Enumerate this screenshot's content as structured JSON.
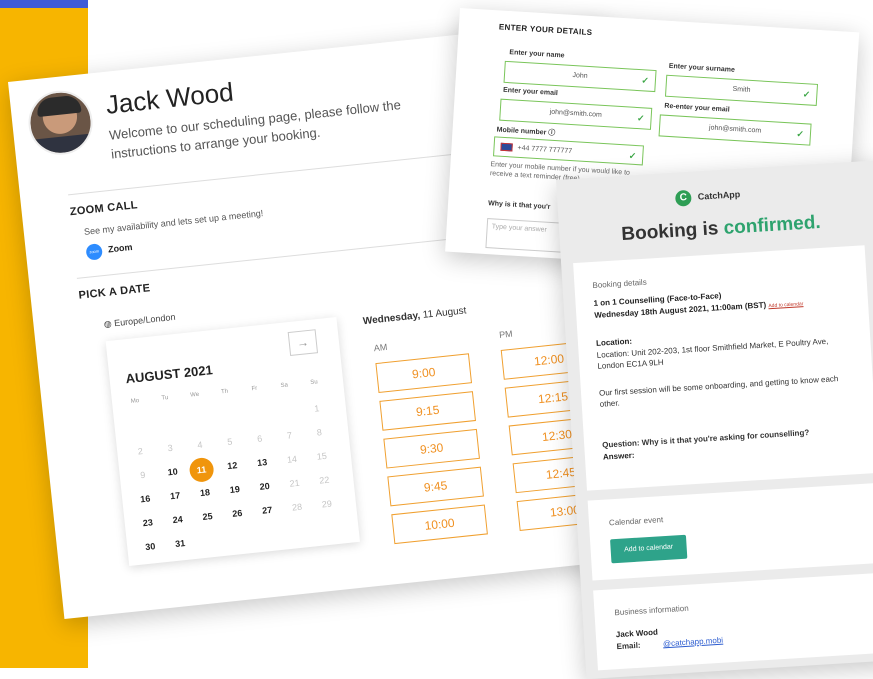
{
  "scheduler": {
    "name": "Jack Wood",
    "welcome": "Welcome to our scheduling page, please follow the instructions to arrange your booking.",
    "zoom_call_heading": "ZOOM CALL",
    "zoom_desc": "See my availability and lets set up a meeting!",
    "zoom_label": "Zoom",
    "zoom_logo_text": "zoom",
    "pick_date_heading": "PICK A DATE",
    "timezone": "Europe/London",
    "month": "AUGUST 2021",
    "next_arrow": "→",
    "weekdays": [
      "Mo",
      "Tu",
      "We",
      "Th",
      "Fr",
      "Sa",
      "Su"
    ],
    "selected_day": "11",
    "date_heading_day": "Wednesday,",
    "date_heading_date": "11 August",
    "am_label": "AM",
    "pm_label": "PM",
    "am_slots": [
      "9:00",
      "9:15",
      "9:30",
      "9:45",
      "10:00"
    ],
    "pm_slots": [
      "12:00",
      "12:15",
      "12:30",
      "12:45",
      "13:00"
    ]
  },
  "details": {
    "heading": "ENTER YOUR DETAILS",
    "first_name_label": "Enter your name",
    "first_name_value": "John",
    "surname_label": "Enter your surname",
    "surname_value": "Smith",
    "email_label": "Enter your email",
    "email_value": "john@smith.com",
    "reenter_label": "Re-enter your email",
    "reenter_value": "john@smith.com",
    "mobile_label": "Mobile number",
    "mobile_value": "+44 7777 777777",
    "mobile_help": "Enter your mobile number if you would like to receive a text reminder (free)",
    "question_label": "Why is it that you'r",
    "question_placeholder": "Type your answer"
  },
  "confirmation": {
    "brand": "CatchApp",
    "title_prefix": "Booking is",
    "title_suffix": "confirmed.",
    "booking_details_label": "Booking details",
    "session_title": "1 on 1 Counselling (Face-to-Face)",
    "session_time": "Wednesday 18th August 2021, 11:00am (BST)",
    "add_to_calendar_link": "Add to calendar",
    "location_label": "Location:",
    "location_text": "Location: Unit 202-203, 1st floor Smithfield Market, E Poultry Ave, London EC1A 9LH",
    "session_note": "Our first session will be some onboarding, and getting to know each other.",
    "question_label": "Question:",
    "question_text": "Why is it that you're asking for counselling?",
    "answer_label": "Answer:",
    "calendar_event_label": "Calendar event",
    "add_to_calendar_button": "Add to calendar",
    "business_info_label": "Business information",
    "business_name": "Jack Wood",
    "email_label": "Email:",
    "email_value": "@catchapp.mobi"
  },
  "colors": {
    "accent_orange": "#f09020",
    "brand_green": "#2ea36e",
    "sidebar_yellow": "#f7b500",
    "sidebar_blue": "#3f5bd8"
  }
}
